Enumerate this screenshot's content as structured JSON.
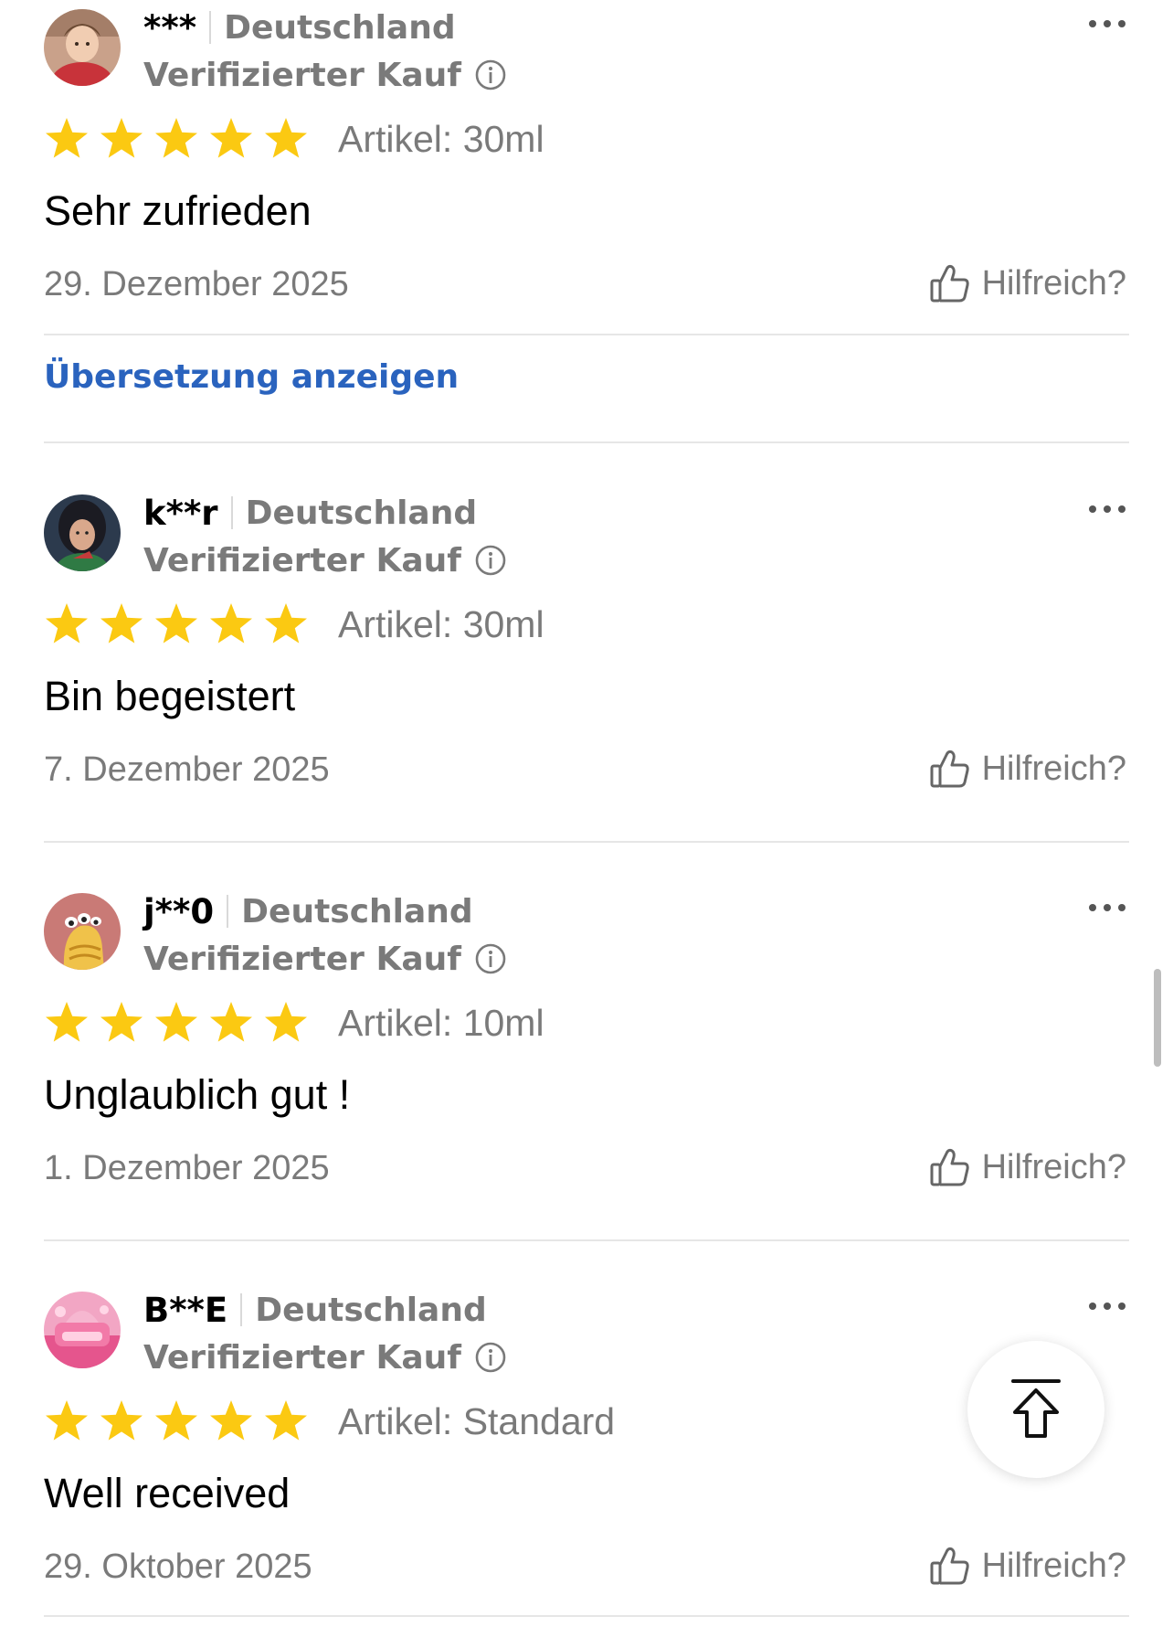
{
  "reviews": [
    {
      "username": "***",
      "country": "Deutschland",
      "verified": "Verifizierter Kauf",
      "rating": 5,
      "article": "Artikel: 30ml",
      "content": "Sehr zufrieden",
      "date": "29. Dezember 2025",
      "helpful": "Hilfreich?",
      "translate": "Übersetzung anzeigen"
    },
    {
      "username": "k**r",
      "country": "Deutschland",
      "verified": "Verifizierter Kauf",
      "rating": 5,
      "article": "Artikel: 30ml",
      "content": "Bin begeistert",
      "date": "7. Dezember 2025",
      "helpful": "Hilfreich?"
    },
    {
      "username": "j**0",
      "country": "Deutschland",
      "verified": "Verifizierter Kauf",
      "rating": 5,
      "article": "Artikel: 10ml",
      "content": "Unglaublich gut !",
      "date": "1. Dezember 2025",
      "helpful": "Hilfreich?"
    },
    {
      "username": "B**E",
      "country": "Deutschland",
      "verified": "Verifizierter Kauf",
      "rating": 5,
      "article": "Artikel: Standard",
      "content": "Well received",
      "date": "29. Oktober 2025",
      "helpful": "Hilfreich?"
    }
  ],
  "colors": {
    "star": "#fbc912",
    "link": "#2a63be",
    "muted": "#7a7a7a",
    "divider": "#e6e6e6"
  },
  "icons": {
    "more": "more-horizontal-icon",
    "info": "info-circle-icon",
    "helpful": "thumbs-up-icon",
    "back_to_top": "arrow-up-to-top-icon"
  }
}
